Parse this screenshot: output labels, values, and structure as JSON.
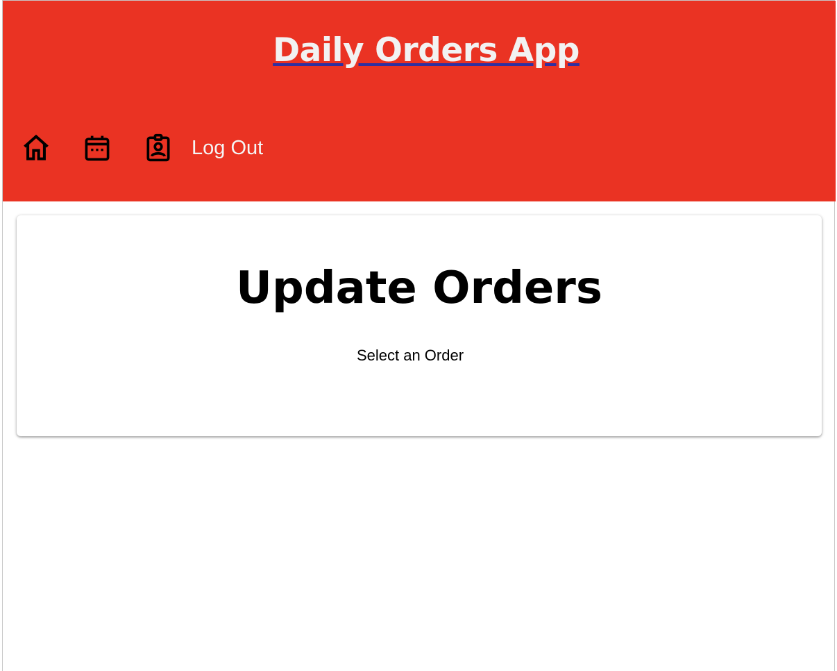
{
  "header": {
    "app_title": "Daily Orders App",
    "background_color": "#ea3323",
    "nav": {
      "icons": [
        "home-icon",
        "calendar-icon",
        "contact-badge-icon"
      ],
      "logout_label": "Log Out"
    }
  },
  "main": {
    "title": "Update Orders",
    "subtitle": "Select an Order"
  }
}
